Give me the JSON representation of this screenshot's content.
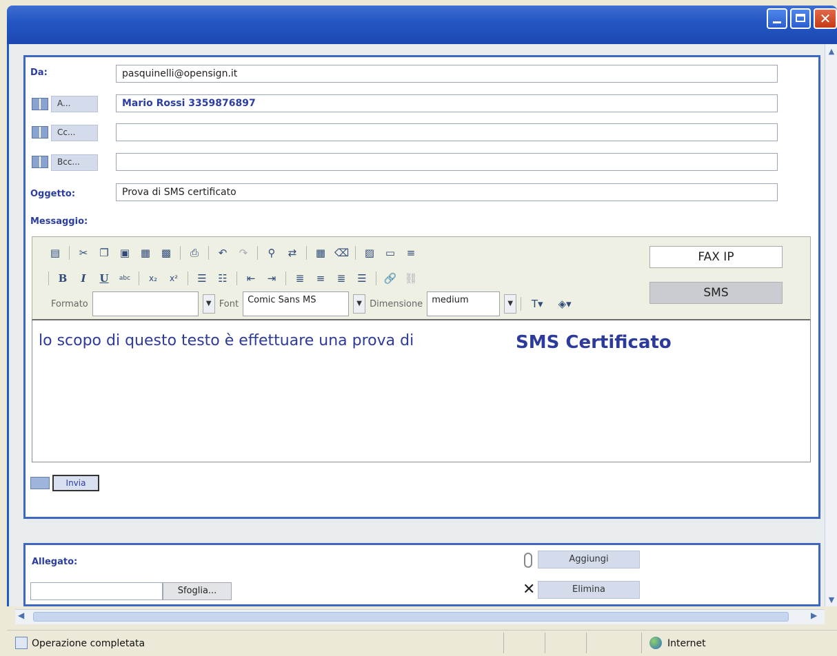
{
  "form": {
    "from_label": "Da:",
    "from_value": "pasquinelli@opensign.it",
    "to_button": "A...",
    "to_value": "Mario Rossi 3359876897",
    "cc_button": "Cc...",
    "cc_value": "",
    "bcc_button": "Bcc...",
    "bcc_value": "",
    "subject_label": "Oggetto:",
    "subject_value": "Prova di SMS certificato",
    "message_label": "Messaggio:"
  },
  "editor": {
    "format_label": "Formato",
    "format_value": "",
    "font_label": "Font",
    "font_value": "Comic Sans MS",
    "size_label": "Dimensione",
    "size_value": "medium",
    "faxip_button": "FAX IP",
    "sms_button": "SMS",
    "body_text": "lo scopo di questo testo è effettuare una prova di",
    "body_bold": "SMS Certificato"
  },
  "actions": {
    "send_button": "Invia"
  },
  "attachment": {
    "label": "Allegato:",
    "browse_button": "Sfoglia...",
    "add_button": "Aggiungi",
    "remove_button": "Elimina"
  },
  "status": {
    "text": "Operazione completata",
    "zone": "Internet"
  },
  "colors": {
    "accent": "#2457c4",
    "label": "#2b3da0"
  },
  "icons": {
    "toolbar_row1": [
      "source-icon",
      "cut-icon",
      "copy-icon",
      "paste-icon",
      "paste-text-icon",
      "paste-word-icon",
      "print-icon",
      "undo-icon",
      "redo-icon",
      "find-icon",
      "replace-icon",
      "select-all-icon",
      "remove-format-icon",
      "image-icon",
      "table-icon",
      "horizontal-rule-icon"
    ],
    "toolbar_row2": [
      "bold-icon",
      "italic-icon",
      "underline-icon",
      "strikethrough-icon",
      "subscript-icon",
      "superscript-icon",
      "numbered-list-icon",
      "bulleted-list-icon",
      "outdent-icon",
      "indent-icon",
      "align-left-icon",
      "align-center-icon",
      "align-right-icon",
      "justify-icon",
      "link-icon",
      "unlink-icon"
    ]
  }
}
